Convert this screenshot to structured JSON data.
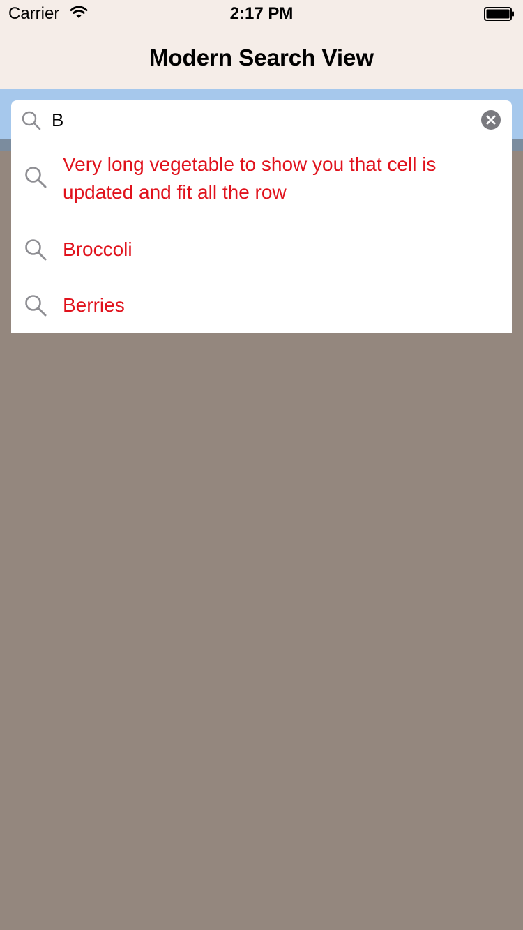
{
  "status_bar": {
    "carrier": "Carrier",
    "time": "2:17 PM"
  },
  "nav": {
    "title": "Modern Search View"
  },
  "search": {
    "value": "B"
  },
  "results": [
    {
      "label": "Very long vegetable to show you that cell is updated and fit all the row"
    },
    {
      "label": "Broccoli"
    },
    {
      "label": "Berries"
    }
  ],
  "colors": {
    "result_text": "#e0121c",
    "background": "#94877e",
    "search_bar": "#a6c8ec",
    "nav_bar": "#f5ede8"
  },
  "icons": [
    "wifi-icon",
    "battery-icon",
    "search-icon",
    "clear-icon"
  ]
}
